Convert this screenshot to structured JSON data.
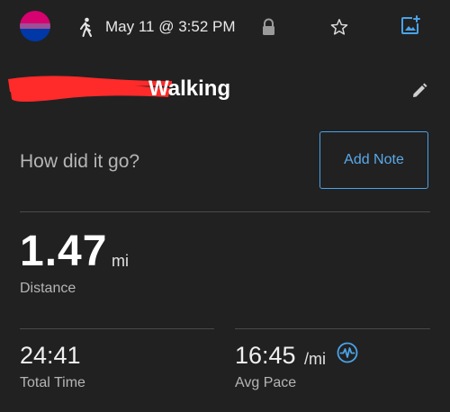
{
  "header": {
    "date": "May 11 @ 3:52 PM",
    "icons": [
      "walking-icon",
      "lock-icon",
      "star-icon",
      "add-photo-icon"
    ]
  },
  "activity": {
    "title": "Walking"
  },
  "note": {
    "prompt": "How did it go?",
    "button_label": "Add Note"
  },
  "stats": {
    "distance": {
      "value": "1.47",
      "unit": "mi",
      "label": "Distance"
    },
    "total_time": {
      "value": "24:41",
      "label": "Total Time"
    },
    "avg_pace": {
      "value": "16:45",
      "unit": "/mi",
      "label": "Avg Pace"
    }
  },
  "colors": {
    "accent": "#4aa3e8",
    "background": "#212121",
    "redaction": "#ff2a2a"
  }
}
